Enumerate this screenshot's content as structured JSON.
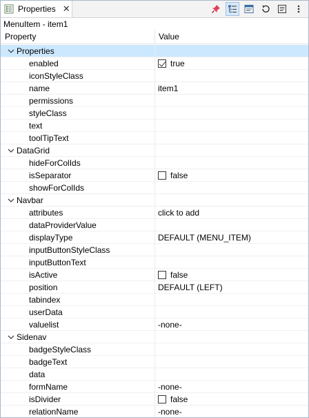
{
  "tab": {
    "title": "Properties",
    "close": "✕"
  },
  "toolbar": {
    "buttons": [
      {
        "icon": "pin-icon",
        "active": false
      },
      {
        "icon": "categories-icon",
        "active": true
      },
      {
        "icon": "filter-advanced-icon",
        "active": false
      },
      {
        "icon": "restore-default-icon",
        "active": false
      },
      {
        "icon": "show-description-icon",
        "active": false
      },
      {
        "icon": "view-menu-icon",
        "active": false
      }
    ]
  },
  "breadcrumb": "MenuItem - item1",
  "header": {
    "property": "Property",
    "value": "Value"
  },
  "rows": [
    {
      "kind": "category",
      "label": "Properties",
      "selected": true
    },
    {
      "kind": "prop",
      "name": "enabled",
      "checkbox": true,
      "checked": true,
      "value": "true"
    },
    {
      "kind": "prop",
      "name": "iconStyleClass",
      "value": ""
    },
    {
      "kind": "prop",
      "name": "name",
      "value": "item1"
    },
    {
      "kind": "prop",
      "name": "permissions",
      "value": ""
    },
    {
      "kind": "prop",
      "name": "styleClass",
      "value": ""
    },
    {
      "kind": "prop",
      "name": "text",
      "value": ""
    },
    {
      "kind": "prop",
      "name": "toolTipText",
      "value": ""
    },
    {
      "kind": "category",
      "label": "DataGrid"
    },
    {
      "kind": "prop",
      "name": "hideForColIds",
      "value": ""
    },
    {
      "kind": "prop",
      "name": "isSeparator",
      "checkbox": true,
      "checked": false,
      "value": "false"
    },
    {
      "kind": "prop",
      "name": "showForColIds",
      "value": ""
    },
    {
      "kind": "category",
      "label": "Navbar"
    },
    {
      "kind": "prop",
      "name": "attributes",
      "value": "click to add"
    },
    {
      "kind": "prop",
      "name": "dataProviderValue",
      "value": ""
    },
    {
      "kind": "prop",
      "name": "displayType",
      "value": "DEFAULT (MENU_ITEM)"
    },
    {
      "kind": "prop",
      "name": "inputButtonStyleClass",
      "value": ""
    },
    {
      "kind": "prop",
      "name": "inputButtonText",
      "value": ""
    },
    {
      "kind": "prop",
      "name": "isActive",
      "checkbox": true,
      "checked": false,
      "value": "false"
    },
    {
      "kind": "prop",
      "name": "position",
      "value": "DEFAULT (LEFT)"
    },
    {
      "kind": "prop",
      "name": "tabindex",
      "value": ""
    },
    {
      "kind": "prop",
      "name": "userData",
      "value": ""
    },
    {
      "kind": "prop",
      "name": "valuelist",
      "value": "-none-"
    },
    {
      "kind": "category",
      "label": "Sidenav"
    },
    {
      "kind": "prop",
      "name": "badgeStyleClass",
      "value": ""
    },
    {
      "kind": "prop",
      "name": "badgeText",
      "value": ""
    },
    {
      "kind": "prop",
      "name": "data",
      "value": ""
    },
    {
      "kind": "prop",
      "name": "formName",
      "value": "-none-"
    },
    {
      "kind": "prop",
      "name": "isDivider",
      "checkbox": true,
      "checked": false,
      "value": "false"
    },
    {
      "kind": "prop",
      "name": "relationName",
      "value": "-none-"
    }
  ]
}
